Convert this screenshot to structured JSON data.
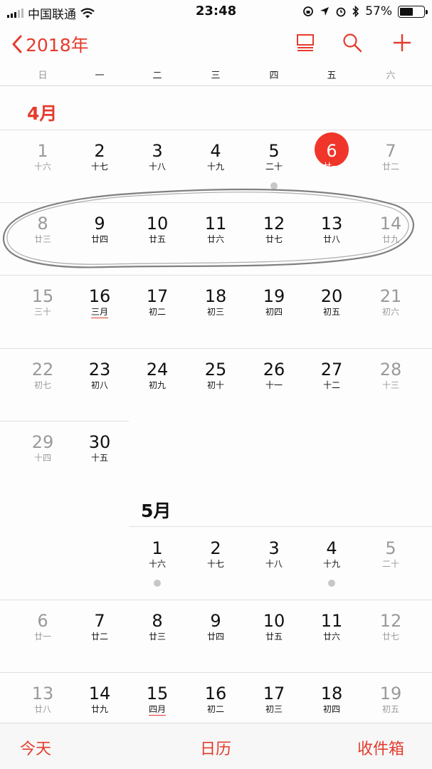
{
  "status": {
    "carrier": "中国联通",
    "time": "23:48",
    "battery": "57%",
    "battery_level": 0.57
  },
  "nav": {
    "back_label": "2018年",
    "icons": [
      "list-view-icon",
      "search-icon",
      "add-icon"
    ],
    "accent": "#e63b2e"
  },
  "weekdays": [
    "日",
    "一",
    "二",
    "三",
    "四",
    "五",
    "六"
  ],
  "april": {
    "title": "4月",
    "weeks": [
      [
        [
          "1",
          "十六"
        ],
        [
          "2",
          "十七"
        ],
        [
          "3",
          "十八"
        ],
        [
          "4",
          "十九"
        ],
        [
          "5",
          "二十"
        ],
        [
          "6",
          "廿一"
        ],
        [
          "7",
          "廿二"
        ]
      ],
      [
        [
          "8",
          "廿三"
        ],
        [
          "9",
          "廿四"
        ],
        [
          "10",
          "廿五"
        ],
        [
          "11",
          "廿六"
        ],
        [
          "12",
          "廿七"
        ],
        [
          "13",
          "廿八"
        ],
        [
          "14",
          "廿九"
        ]
      ],
      [
        [
          "15",
          "三十"
        ],
        [
          "16",
          "三月"
        ],
        [
          "17",
          "初二"
        ],
        [
          "18",
          "初三"
        ],
        [
          "19",
          "初四"
        ],
        [
          "20",
          "初五"
        ],
        [
          "21",
          "初六"
        ]
      ],
      [
        [
          "22",
          "初七"
        ],
        [
          "23",
          "初八"
        ],
        [
          "24",
          "初九"
        ],
        [
          "25",
          "初十"
        ],
        [
          "26",
          "十一"
        ],
        [
          "27",
          "十二"
        ],
        [
          "28",
          "十三"
        ]
      ],
      [
        [
          "29",
          "十四"
        ],
        [
          "30",
          "十五"
        ]
      ]
    ]
  },
  "may": {
    "title": "5月",
    "weeks": [
      [
        [
          "1",
          "十六"
        ],
        [
          "2",
          "十七"
        ],
        [
          "3",
          "十八"
        ],
        [
          "4",
          "十九"
        ],
        [
          "5",
          "二十"
        ]
      ],
      [
        [
          "6",
          "廿一"
        ],
        [
          "7",
          "廿二"
        ],
        [
          "8",
          "廿三"
        ],
        [
          "9",
          "廿四"
        ],
        [
          "10",
          "廿五"
        ],
        [
          "11",
          "廿六"
        ],
        [
          "12",
          "廿七"
        ]
      ],
      [
        [
          "13",
          "廿八"
        ],
        [
          "14",
          "廿九"
        ],
        [
          "15",
          "四月"
        ],
        [
          "16",
          "初二"
        ],
        [
          "17",
          "初三"
        ],
        [
          "18",
          "初四"
        ],
        [
          "19",
          "初五"
        ]
      ]
    ]
  },
  "today": "6",
  "tabs": {
    "today": "今天",
    "calendars": "日历",
    "inbox": "收件箱"
  }
}
